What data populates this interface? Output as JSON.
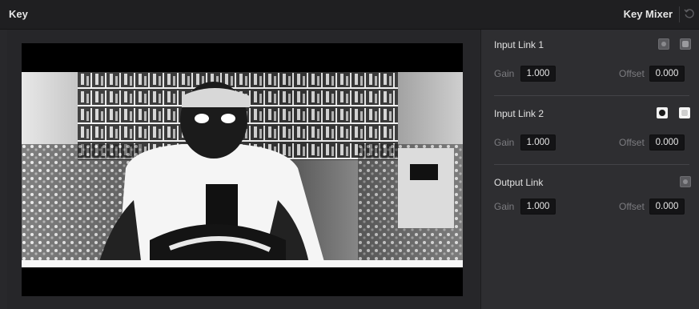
{
  "titlebar": {
    "title": "Key",
    "panel_title": "Key Mixer"
  },
  "icons": {
    "reset": "reset-icon",
    "mask": "circle-mask-icon",
    "square": "square-icon"
  },
  "colors": {
    "panel_bg": "#2e2e31",
    "field_bg": "#141416",
    "label": "#7c7c80"
  },
  "sections": [
    {
      "title": "Input Link 1",
      "gain_label": "Gain",
      "gain": "1.000",
      "offset_label": "Offset",
      "offset": "0.000"
    },
    {
      "title": "Input Link 2",
      "gain_label": "Gain",
      "gain": "1.000",
      "offset_label": "Offset",
      "offset": "0.000"
    },
    {
      "title": "Output Link",
      "gain_label": "Gain",
      "gain": "1.000",
      "offset_label": "Offset",
      "offset": "0.000"
    }
  ]
}
